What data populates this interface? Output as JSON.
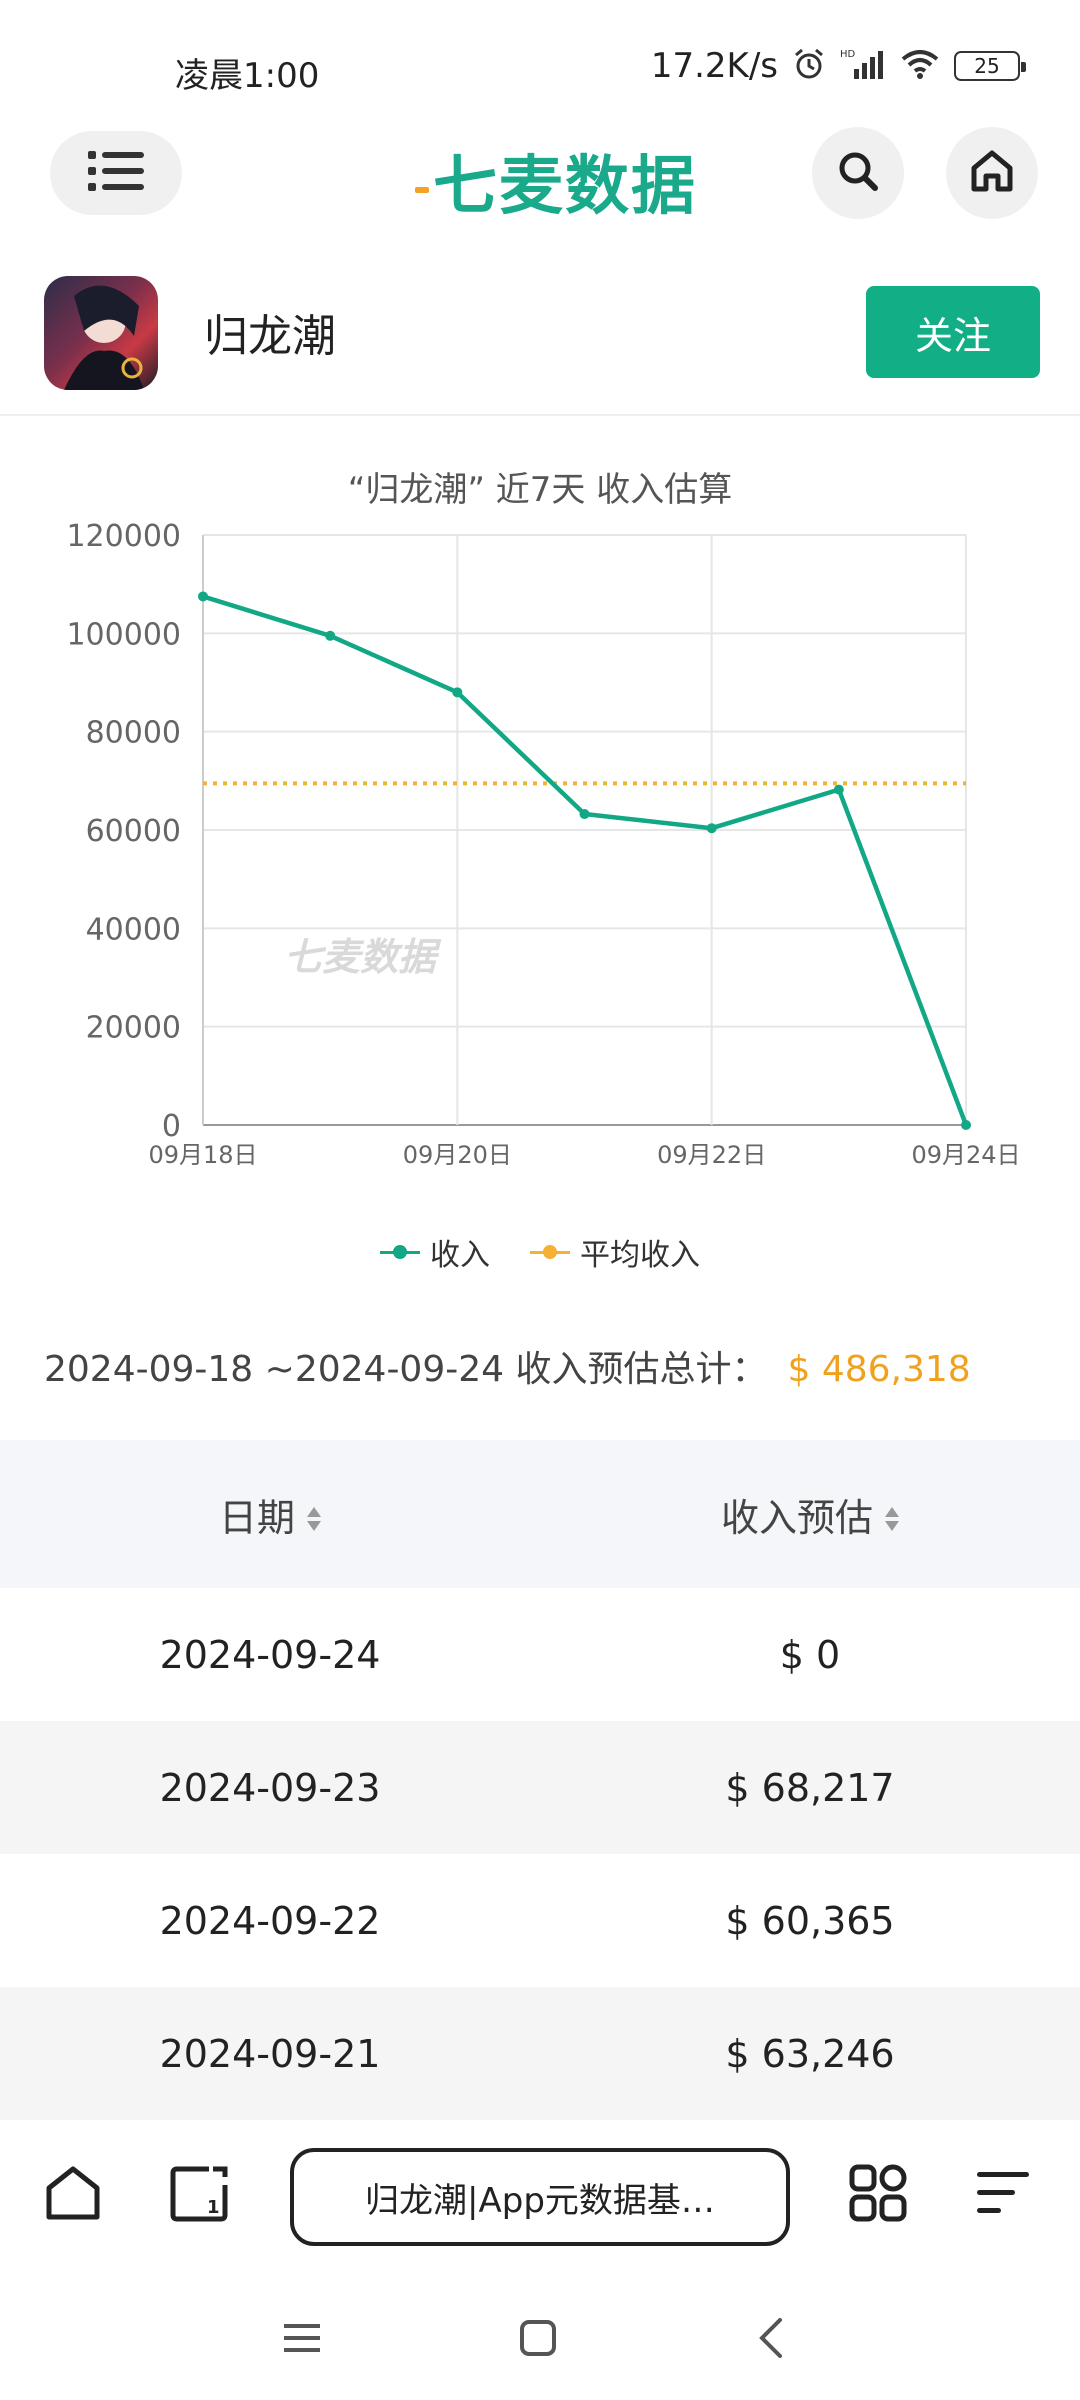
{
  "status_bar": {
    "time": "凌晨1:00",
    "net_speed": "17.2K/s",
    "battery": "25"
  },
  "header": {
    "logo": "七麦数据",
    "menu_icon": "list-icon",
    "search_icon": "search-icon",
    "home_icon": "home-icon"
  },
  "app": {
    "name": "归龙潮",
    "follow_label": "关注"
  },
  "chart_data": {
    "type": "line",
    "title": "“归龙潮” 近7天 收入估算",
    "watermark": "七麦数据",
    "x": [
      "09月18日",
      "09月19日",
      "09月20日",
      "09月21日",
      "09月22日",
      "09月23日",
      "09月24日"
    ],
    "x_tick_labels": [
      "09月18日",
      "09月20日",
      "09月22日",
      "09月24日"
    ],
    "series": [
      {
        "name": "收入",
        "color": "#12a886",
        "values": [
          107500,
          99500,
          88000,
          63246,
          60365,
          68217,
          0
        ]
      },
      {
        "name": "平均收入",
        "color": "#f5b133",
        "style": "dotted",
        "values": [
          69474,
          69474,
          69474,
          69474,
          69474,
          69474,
          69474
        ]
      }
    ],
    "y_ticks": [
      0,
      20000,
      40000,
      60000,
      80000,
      100000,
      120000
    ],
    "ylim": [
      0,
      120000
    ],
    "grid": true,
    "legend_position": "bottom"
  },
  "summary": {
    "range_label": "2024-09-18  ~2024-09-24 收入预估总计：",
    "total": "$ 486,318"
  },
  "table": {
    "headers": [
      "日期",
      "收入预估"
    ],
    "rows": [
      {
        "date": "2024-09-24",
        "revenue": "$ 0"
      },
      {
        "date": "2024-09-23",
        "revenue": "$ 68,217"
      },
      {
        "date": "2024-09-22",
        "revenue": "$ 60,365"
      },
      {
        "date": "2024-09-21",
        "revenue": "$ 63,246"
      }
    ]
  },
  "browser": {
    "url_title": "归龙潮|App元数据基…"
  }
}
